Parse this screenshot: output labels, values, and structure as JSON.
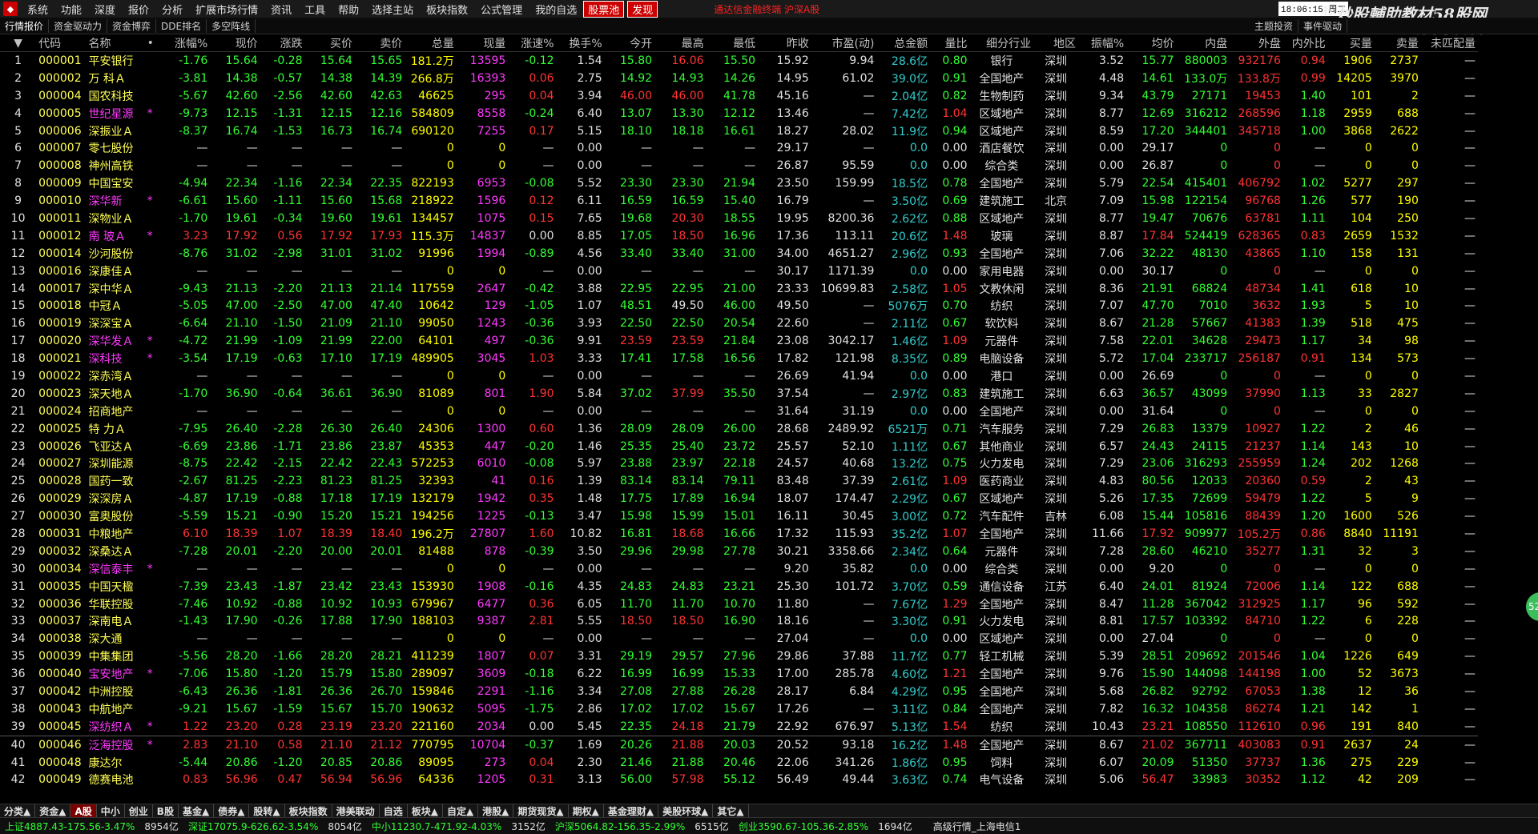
{
  "menu": [
    "系统",
    "功能",
    "深度",
    "报价",
    "分析",
    "扩展市场行情",
    "资讯",
    "工具",
    "帮助",
    "选择主站",
    "板块指数",
    "公式管理",
    "我的自选"
  ],
  "menu_highlight": [
    "股票池",
    "发现"
  ],
  "ticker": "通达信金融终端 沪深A股",
  "clock": "18:06:15 周二",
  "menu_last": "行",
  "watermark": "炒股輔助教材58股网",
  "watermark_url": "www.58Gu.com",
  "tabs": [
    "行情报价",
    "资金驱动力",
    "资金博弈",
    "DDE排名",
    "多空阵线"
  ],
  "tabs_right": [
    "主题投资",
    "事件驱动"
  ],
  "columns": [
    "▼",
    "代码",
    "名称",
    "•",
    "涨幅%",
    "现价",
    "涨跌",
    "买价",
    "卖价",
    "总量",
    "现量",
    "涨速%",
    "换手%",
    "今开",
    "最高",
    "最低",
    "昨收",
    "市盈(动)",
    "总金额",
    "量比",
    "细分行业",
    "地区",
    "振幅%",
    "均价",
    "内盘",
    "外盘",
    "内外比",
    "买量",
    "卖量",
    "未匹配量"
  ],
  "rows": [
    [
      "1",
      "000001",
      "平安银行",
      "",
      "-1.76",
      "15.64",
      "-0.28",
      "15.64",
      "15.65",
      "181.2万",
      "13595",
      "-0.12",
      "1.54",
      "15.80",
      "16.06",
      "15.50",
      "15.92",
      "9.94",
      "28.6亿",
      "0.80",
      "银行",
      "深圳",
      "3.52",
      "15.77",
      "880003",
      "932176",
      "0.94",
      "1906",
      "2737",
      "—"
    ],
    [
      "2",
      "000002",
      "万 科Ａ",
      "",
      "-3.81",
      "14.38",
      "-0.57",
      "14.38",
      "14.39",
      "266.8万",
      "16393",
      "0.06",
      "2.75",
      "14.92",
      "14.93",
      "14.26",
      "14.95",
      "61.02",
      "39.0亿",
      "0.91",
      "全国地产",
      "深圳",
      "4.48",
      "14.61",
      "133.0万",
      "133.8万",
      "0.99",
      "14205",
      "3970",
      "—"
    ],
    [
      "3",
      "000004",
      "国农科技",
      "",
      "-5.67",
      "42.60",
      "-2.56",
      "42.60",
      "42.63",
      "46625",
      "295",
      "0.04",
      "3.94",
      "46.00",
      "46.00",
      "41.78",
      "45.16",
      "—",
      "2.04亿",
      "0.82",
      "生物制药",
      "深圳",
      "9.34",
      "43.79",
      "27171",
      "19453",
      "1.40",
      "101",
      "2",
      "—"
    ],
    [
      "4",
      "000005",
      "世纪星源",
      "*",
      "-9.73",
      "12.15",
      "-1.31",
      "12.15",
      "12.16",
      "584809",
      "8558",
      "-0.24",
      "6.40",
      "13.07",
      "13.30",
      "12.12",
      "13.46",
      "—",
      "7.42亿",
      "1.04",
      "区域地产",
      "深圳",
      "8.77",
      "12.69",
      "316212",
      "268596",
      "1.18",
      "2959",
      "688",
      "—"
    ],
    [
      "5",
      "000006",
      "深振业Ａ",
      "",
      "-8.37",
      "16.74",
      "-1.53",
      "16.73",
      "16.74",
      "690120",
      "7255",
      "0.17",
      "5.15",
      "18.10",
      "18.18",
      "16.61",
      "18.27",
      "28.02",
      "11.9亿",
      "0.94",
      "区域地产",
      "深圳",
      "8.59",
      "17.20",
      "344401",
      "345718",
      "1.00",
      "3868",
      "2622",
      "—"
    ],
    [
      "6",
      "000007",
      "零七股份",
      "",
      "—",
      "—",
      "—",
      "—",
      "—",
      "0",
      "0",
      "—",
      "0.00",
      "—",
      "—",
      "—",
      "29.17",
      "—",
      "0.0",
      "0.00",
      "酒店餐饮",
      "深圳",
      "0.00",
      "29.17",
      "0",
      "0",
      "—",
      "0",
      "0",
      "—"
    ],
    [
      "7",
      "000008",
      "神州高铁",
      "",
      "—",
      "—",
      "—",
      "—",
      "—",
      "0",
      "0",
      "—",
      "0.00",
      "—",
      "—",
      "—",
      "26.87",
      "95.59",
      "0.0",
      "0.00",
      "综合类",
      "深圳",
      "0.00",
      "26.87",
      "0",
      "0",
      "—",
      "0",
      "0",
      "—"
    ],
    [
      "8",
      "000009",
      "中国宝安",
      "",
      "-4.94",
      "22.34",
      "-1.16",
      "22.34",
      "22.35",
      "822193",
      "6953",
      "-0.08",
      "5.52",
      "23.30",
      "23.30",
      "21.94",
      "23.50",
      "159.99",
      "18.5亿",
      "0.78",
      "全国地产",
      "深圳",
      "5.79",
      "22.54",
      "415401",
      "406792",
      "1.02",
      "5277",
      "297",
      "—"
    ],
    [
      "9",
      "000010",
      "深华新",
      "*",
      "-6.61",
      "15.60",
      "-1.11",
      "15.60",
      "15.68",
      "218922",
      "1596",
      "0.12",
      "6.11",
      "16.59",
      "16.59",
      "15.40",
      "16.79",
      "—",
      "3.50亿",
      "0.69",
      "建筑施工",
      "北京",
      "7.09",
      "15.98",
      "122154",
      "96768",
      "1.26",
      "577",
      "190",
      "—"
    ],
    [
      "10",
      "000011",
      "深物业Ａ",
      "",
      "-1.70",
      "19.61",
      "-0.34",
      "19.60",
      "19.61",
      "134457",
      "1075",
      "0.15",
      "7.65",
      "19.68",
      "20.30",
      "18.55",
      "19.95",
      "8200.36",
      "2.62亿",
      "0.88",
      "区域地产",
      "深圳",
      "8.77",
      "19.47",
      "70676",
      "63781",
      "1.11",
      "104",
      "250",
      "—"
    ],
    [
      "11",
      "000012",
      "南 玻Ａ",
      "*",
      "3.23",
      "17.92",
      "0.56",
      "17.92",
      "17.93",
      "115.3万",
      "14837",
      "0.00",
      "8.85",
      "17.05",
      "18.50",
      "16.96",
      "17.36",
      "113.11",
      "20.6亿",
      "1.48",
      "玻璃",
      "深圳",
      "8.87",
      "17.84",
      "524419",
      "628365",
      "0.83",
      "2659",
      "1532",
      "—"
    ],
    [
      "12",
      "000014",
      "沙河股份",
      "",
      "-8.76",
      "31.02",
      "-2.98",
      "31.01",
      "31.02",
      "91996",
      "1994",
      "-0.89",
      "4.56",
      "33.40",
      "33.40",
      "31.00",
      "34.00",
      "4651.27",
      "2.96亿",
      "0.93",
      "全国地产",
      "深圳",
      "7.06",
      "32.22",
      "48130",
      "43865",
      "1.10",
      "158",
      "131",
      "—"
    ],
    [
      "13",
      "000016",
      "深康佳Ａ",
      "",
      "—",
      "—",
      "—",
      "—",
      "—",
      "0",
      "0",
      "—",
      "0.00",
      "—",
      "—",
      "—",
      "30.17",
      "1171.39",
      "0.0",
      "0.00",
      "家用电器",
      "深圳",
      "0.00",
      "30.17",
      "0",
      "0",
      "—",
      "0",
      "0",
      "—"
    ],
    [
      "14",
      "000017",
      "深中华Ａ",
      "",
      "-9.43",
      "21.13",
      "-2.20",
      "21.13",
      "21.14",
      "117559",
      "2647",
      "-0.42",
      "3.88",
      "22.95",
      "22.95",
      "21.00",
      "23.33",
      "10699.83",
      "2.58亿",
      "1.05",
      "文教休闲",
      "深圳",
      "8.36",
      "21.91",
      "68824",
      "48734",
      "1.41",
      "618",
      "10",
      "—"
    ],
    [
      "15",
      "000018",
      "中冠Ａ",
      "",
      "-5.05",
      "47.00",
      "-2.50",
      "47.00",
      "47.40",
      "10642",
      "129",
      "-1.05",
      "1.07",
      "48.51",
      "49.50",
      "46.00",
      "49.50",
      "—",
      "5076万",
      "0.70",
      "纺织",
      "深圳",
      "7.07",
      "47.70",
      "7010",
      "3632",
      "1.93",
      "5",
      "10",
      "—"
    ],
    [
      "16",
      "000019",
      "深深宝Ａ",
      "",
      "-6.64",
      "21.10",
      "-1.50",
      "21.09",
      "21.10",
      "99050",
      "1243",
      "-0.36",
      "3.93",
      "22.50",
      "22.50",
      "20.54",
      "22.60",
      "—",
      "2.11亿",
      "0.67",
      "软饮料",
      "深圳",
      "8.67",
      "21.28",
      "57667",
      "41383",
      "1.39",
      "518",
      "475",
      "—"
    ],
    [
      "17",
      "000020",
      "深华发Ａ",
      "*",
      "-4.72",
      "21.99",
      "-1.09",
      "21.99",
      "22.00",
      "64101",
      "497",
      "-0.36",
      "9.91",
      "23.59",
      "23.59",
      "21.84",
      "23.08",
      "3042.17",
      "1.46亿",
      "1.09",
      "元器件",
      "深圳",
      "7.58",
      "22.01",
      "34628",
      "29473",
      "1.17",
      "34",
      "98",
      "—"
    ],
    [
      "18",
      "000021",
      "深科技",
      "*",
      "-3.54",
      "17.19",
      "-0.63",
      "17.10",
      "17.19",
      "489905",
      "3045",
      "1.03",
      "3.33",
      "17.41",
      "17.58",
      "16.56",
      "17.82",
      "121.98",
      "8.35亿",
      "0.89",
      "电脑设备",
      "深圳",
      "5.72",
      "17.04",
      "233717",
      "256187",
      "0.91",
      "134",
      "573",
      "—"
    ],
    [
      "19",
      "000022",
      "深赤湾Ａ",
      "",
      "—",
      "—",
      "—",
      "—",
      "—",
      "0",
      "0",
      "—",
      "0.00",
      "—",
      "—",
      "—",
      "26.69",
      "41.94",
      "0.0",
      "0.00",
      "港口",
      "深圳",
      "0.00",
      "26.69",
      "0",
      "0",
      "—",
      "0",
      "0",
      "—"
    ],
    [
      "20",
      "000023",
      "深天地Ａ",
      "",
      "-1.70",
      "36.90",
      "-0.64",
      "36.61",
      "36.90",
      "81089",
      "801",
      "1.90",
      "5.84",
      "37.02",
      "37.99",
      "35.50",
      "37.54",
      "—",
      "2.97亿",
      "0.83",
      "建筑施工",
      "深圳",
      "6.63",
      "36.57",
      "43099",
      "37990",
      "1.13",
      "33",
      "2827",
      "—"
    ],
    [
      "21",
      "000024",
      "招商地产",
      "",
      "—",
      "—",
      "—",
      "—",
      "—",
      "0",
      "0",
      "—",
      "0.00",
      "—",
      "—",
      "—",
      "31.64",
      "31.19",
      "0.0",
      "0.00",
      "全国地产",
      "深圳",
      "0.00",
      "31.64",
      "0",
      "0",
      "—",
      "0",
      "0",
      "—"
    ],
    [
      "22",
      "000025",
      "特 力Ａ",
      "",
      "-7.95",
      "26.40",
      "-2.28",
      "26.30",
      "26.40",
      "24306",
      "1300",
      "0.60",
      "1.36",
      "28.09",
      "28.09",
      "26.00",
      "28.68",
      "2489.92",
      "6521万",
      "0.71",
      "汽车服务",
      "深圳",
      "7.29",
      "26.83",
      "13379",
      "10927",
      "1.22",
      "2",
      "46",
      "—"
    ],
    [
      "23",
      "000026",
      "飞亚达Ａ",
      "",
      "-6.69",
      "23.86",
      "-1.71",
      "23.86",
      "23.87",
      "45353",
      "447",
      "-0.20",
      "1.46",
      "25.35",
      "25.40",
      "23.72",
      "25.57",
      "52.10",
      "1.11亿",
      "0.67",
      "其他商业",
      "深圳",
      "6.57",
      "24.43",
      "24115",
      "21237",
      "1.14",
      "143",
      "10",
      "—"
    ],
    [
      "24",
      "000027",
      "深圳能源",
      "",
      "-8.75",
      "22.42",
      "-2.15",
      "22.42",
      "22.43",
      "572253",
      "6010",
      "-0.08",
      "5.97",
      "23.88",
      "23.97",
      "22.18",
      "24.57",
      "40.68",
      "13.2亿",
      "0.75",
      "火力发电",
      "深圳",
      "7.29",
      "23.06",
      "316293",
      "255959",
      "1.24",
      "202",
      "1268",
      "—"
    ],
    [
      "25",
      "000028",
      "国药一致",
      "",
      "-2.67",
      "81.25",
      "-2.23",
      "81.23",
      "81.25",
      "32393",
      "41",
      "0.16",
      "1.39",
      "83.14",
      "83.14",
      "79.11",
      "83.48",
      "37.39",
      "2.61亿",
      "1.09",
      "医药商业",
      "深圳",
      "4.83",
      "80.56",
      "12033",
      "20360",
      "0.59",
      "2",
      "43",
      "—"
    ],
    [
      "26",
      "000029",
      "深深房Ａ",
      "",
      "-4.87",
      "17.19",
      "-0.88",
      "17.18",
      "17.19",
      "132179",
      "1942",
      "0.35",
      "1.48",
      "17.75",
      "17.89",
      "16.94",
      "18.07",
      "174.47",
      "2.29亿",
      "0.67",
      "区域地产",
      "深圳",
      "5.26",
      "17.35",
      "72699",
      "59479",
      "1.22",
      "5",
      "9",
      "—"
    ],
    [
      "27",
      "000030",
      "富奥股份",
      "",
      "-5.59",
      "15.21",
      "-0.90",
      "15.20",
      "15.21",
      "194256",
      "1225",
      "-0.13",
      "3.47",
      "15.98",
      "15.99",
      "15.01",
      "16.11",
      "30.45",
      "3.00亿",
      "0.72",
      "汽车配件",
      "吉林",
      "6.08",
      "15.44",
      "105816",
      "88439",
      "1.20",
      "1600",
      "526",
      "—"
    ],
    [
      "28",
      "000031",
      "中粮地产",
      "",
      "6.10",
      "18.39",
      "1.07",
      "18.39",
      "18.40",
      "196.2万",
      "27807",
      "1.60",
      "10.82",
      "16.81",
      "18.68",
      "16.66",
      "17.32",
      "115.93",
      "35.2亿",
      "1.07",
      "全国地产",
      "深圳",
      "11.66",
      "17.92",
      "909977",
      "105.2万",
      "0.86",
      "8840",
      "11191",
      "—"
    ],
    [
      "29",
      "000032",
      "深桑达Ａ",
      "",
      "-7.28",
      "20.01",
      "-2.20",
      "20.00",
      "20.01",
      "81488",
      "878",
      "-0.39",
      "3.50",
      "29.96",
      "29.98",
      "27.78",
      "30.21",
      "3358.66",
      "2.34亿",
      "0.64",
      "元器件",
      "深圳",
      "7.28",
      "28.60",
      "46210",
      "35277",
      "1.31",
      "32",
      "3",
      "—"
    ],
    [
      "30",
      "000034",
      "深信泰丰",
      "*",
      "—",
      "—",
      "—",
      "—",
      "—",
      "0",
      "0",
      "—",
      "0.00",
      "—",
      "—",
      "—",
      "9.20",
      "35.82",
      "0.0",
      "0.00",
      "综合类",
      "深圳",
      "0.00",
      "9.20",
      "0",
      "0",
      "—",
      "0",
      "0",
      "—"
    ],
    [
      "31",
      "000035",
      "中国天楹",
      "",
      "-7.39",
      "23.43",
      "-1.87",
      "23.42",
      "23.43",
      "153930",
      "1908",
      "-0.16",
      "4.35",
      "24.83",
      "24.83",
      "23.21",
      "25.30",
      "101.72",
      "3.70亿",
      "0.59",
      "通信设备",
      "江苏",
      "6.40",
      "24.01",
      "81924",
      "72006",
      "1.14",
      "122",
      "688",
      "—"
    ],
    [
      "32",
      "000036",
      "华联控股",
      "",
      "-7.46",
      "10.92",
      "-0.88",
      "10.92",
      "10.93",
      "679967",
      "6477",
      "0.36",
      "6.05",
      "11.70",
      "11.70",
      "10.70",
      "11.80",
      "—",
      "7.67亿",
      "1.29",
      "全国地产",
      "深圳",
      "8.47",
      "11.28",
      "367042",
      "312925",
      "1.17",
      "96",
      "592",
      "—"
    ],
    [
      "33",
      "000037",
      "深南电Ａ",
      "",
      "-1.43",
      "17.90",
      "-0.26",
      "17.88",
      "17.90",
      "188103",
      "9387",
      "2.81",
      "5.55",
      "18.50",
      "18.50",
      "16.90",
      "18.16",
      "—",
      "3.30亿",
      "0.91",
      "火力发电",
      "深圳",
      "8.81",
      "17.57",
      "103392",
      "84710",
      "1.22",
      "6",
      "228",
      "—"
    ],
    [
      "34",
      "000038",
      "深大通",
      "",
      "—",
      "—",
      "—",
      "—",
      "—",
      "0",
      "0",
      "—",
      "0.00",
      "—",
      "—",
      "—",
      "27.04",
      "—",
      "0.0",
      "0.00",
      "区域地产",
      "深圳",
      "0.00",
      "27.04",
      "0",
      "0",
      "—",
      "0",
      "0",
      "—"
    ],
    [
      "35",
      "000039",
      "中集集团",
      "",
      "-5.56",
      "28.20",
      "-1.66",
      "28.20",
      "28.21",
      "411239",
      "1807",
      "0.07",
      "3.31",
      "29.19",
      "29.57",
      "27.96",
      "29.86",
      "37.88",
      "11.7亿",
      "0.77",
      "轻工机械",
      "深圳",
      "5.39",
      "28.51",
      "209692",
      "201546",
      "1.04",
      "1226",
      "649",
      "—"
    ],
    [
      "36",
      "000040",
      "宝安地产",
      "*",
      "-7.06",
      "15.80",
      "-1.20",
      "15.79",
      "15.80",
      "289097",
      "3609",
      "-0.18",
      "6.22",
      "16.99",
      "16.99",
      "15.33",
      "17.00",
      "285.78",
      "4.60亿",
      "1.21",
      "全国地产",
      "深圳",
      "9.76",
      "15.90",
      "144098",
      "144198",
      "1.00",
      "52",
      "3673",
      "—"
    ],
    [
      "37",
      "000042",
      "中洲控股",
      "",
      "-6.43",
      "26.36",
      "-1.81",
      "26.36",
      "26.70",
      "159846",
      "2291",
      "-1.16",
      "3.34",
      "27.08",
      "27.88",
      "26.28",
      "28.17",
      "6.84",
      "4.29亿",
      "0.95",
      "全国地产",
      "深圳",
      "5.68",
      "26.82",
      "92792",
      "67053",
      "1.38",
      "12",
      "36",
      "—"
    ],
    [
      "38",
      "000043",
      "中航地产",
      "",
      "-9.21",
      "15.67",
      "-1.59",
      "15.67",
      "15.70",
      "190632",
      "5095",
      "-1.75",
      "2.86",
      "17.02",
      "17.02",
      "15.67",
      "17.26",
      "—",
      "3.11亿",
      "0.84",
      "全国地产",
      "深圳",
      "7.82",
      "16.32",
      "104358",
      "86274",
      "1.21",
      "142",
      "1",
      "—"
    ],
    [
      "39",
      "000045",
      "深纺织Ａ",
      "*",
      "1.22",
      "23.20",
      "0.28",
      "23.19",
      "23.20",
      "221160",
      "2034",
      "0.00",
      "5.45",
      "22.35",
      "24.18",
      "21.79",
      "22.92",
      "676.97",
      "5.13亿",
      "1.54",
      "纺织",
      "深圳",
      "10.43",
      "23.21",
      "108550",
      "112610",
      "0.96",
      "191",
      "840",
      "—"
    ],
    [
      "40",
      "000046",
      "泛海控股",
      "*",
      "2.83",
      "21.10",
      "0.58",
      "21.10",
      "21.12",
      "770795",
      "10704",
      "-0.37",
      "1.69",
      "20.26",
      "21.88",
      "20.03",
      "20.52",
      "93.18",
      "16.2亿",
      "1.48",
      "全国地产",
      "深圳",
      "8.67",
      "21.02",
      "367711",
      "403083",
      "0.91",
      "2637",
      "24",
      "—"
    ],
    [
      "41",
      "000048",
      "康达尔",
      "",
      "-5.44",
      "20.86",
      "-1.20",
      "20.85",
      "20.86",
      "89095",
      "273",
      "0.04",
      "2.30",
      "21.46",
      "21.88",
      "20.46",
      "22.06",
      "341.26",
      "1.86亿",
      "0.95",
      "饲料",
      "深圳",
      "6.07",
      "20.09",
      "51350",
      "37737",
      "1.36",
      "275",
      "229",
      "—"
    ],
    [
      "42",
      "000049",
      "德赛电池",
      "",
      "0.83",
      "56.96",
      "0.47",
      "56.94",
      "56.96",
      "64336",
      "1205",
      "0.31",
      "3.13",
      "56.00",
      "57.98",
      "55.12",
      "56.49",
      "49.44",
      "3.63亿",
      "0.74",
      "电气设备",
      "深圳",
      "5.06",
      "56.47",
      "33983",
      "30352",
      "1.12",
      "42",
      "209",
      "—"
    ]
  ],
  "bottom_tabs": [
    "分类▲",
    "资金▲",
    "A股",
    "中小",
    "创业",
    "B股",
    "基金▲",
    "债券▲",
    "股转▲",
    "板块指数",
    "港美联动",
    "自选",
    "板块▲",
    "自定▲",
    "港股▲",
    "期货现货▲",
    "期权▲",
    "基金理财▲",
    "美股环球▲",
    "其它▲"
  ],
  "bottom_active": "A股",
  "status": [
    "上证4887.43-175.56-3.47%",
    "8954亿",
    "深证17075.9-626.62-3.54%",
    "8054亿",
    "中小11230.7-471.92-4.03%",
    "3152亿",
    "沪深5064.82-156.35-2.99%",
    "6515亿",
    "创业3590.67-105.36-2.85%",
    "1694亿",
    "高级行情_上海电信1"
  ],
  "side_tab": "52"
}
